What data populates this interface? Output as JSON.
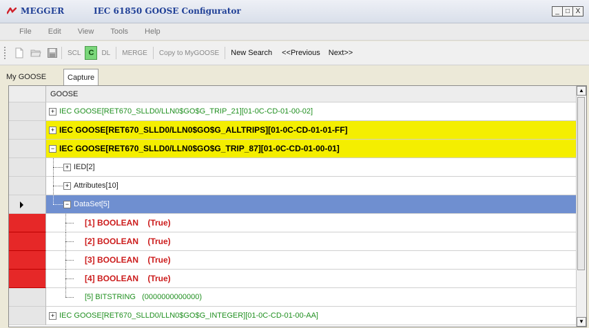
{
  "window": {
    "brand": "MEGGER",
    "title": "IEC 61850 GOOSE Configurator",
    "controls": [
      "_",
      "□",
      "X"
    ]
  },
  "menu": [
    "File",
    "Edit",
    "View",
    "Tools",
    "Help"
  ],
  "toolbar": {
    "scl": "SCL",
    "c": "C",
    "dl": "DL",
    "merge": "MERGE",
    "copy": "Copy to MyGOOSE",
    "new_search": "New Search",
    "previous": "<<Previous",
    "next": "Next>>"
  },
  "tabs": [
    "My GOOSE",
    "Capture"
  ],
  "grid": {
    "header": "GOOSE",
    "rows": [
      {
        "expander": "+",
        "text": "IEC GOOSE[RET670_SLLD0/LLN0$GO$G_TRIP_21][01-0C-CD-01-00-02]",
        "style": "green"
      },
      {
        "expander": "+",
        "text": "IEC GOOSE[RET670_SLLD0/LLN0$GO$G_ALLTRIPS][01-0C-CD-01-01-FF]",
        "style": "yellow"
      },
      {
        "expander": "−",
        "text": "IEC GOOSE[RET670_SLLD0/LLN0$GO$G_TRIP_87][01-0C-CD-01-00-01]",
        "style": "yellow"
      },
      {
        "expander": "+",
        "text": "IED[2]",
        "style": "child"
      },
      {
        "expander": "+",
        "text": "Attributes[10]",
        "style": "child"
      },
      {
        "expander": "−",
        "text": "DataSet[5]",
        "style": "selected"
      },
      {
        "text": "[1] BOOLEAN    (True)",
        "style": "red"
      },
      {
        "text": "[2] BOOLEAN    (True)",
        "style": "red"
      },
      {
        "text": "[3] BOOLEAN    (True)",
        "style": "red"
      },
      {
        "text": "[4] BOOLEAN    (True)",
        "style": "red"
      },
      {
        "text": "[5] BITSTRING   (0000000000000)",
        "style": "green-leaf"
      },
      {
        "expander": "+",
        "text": "IEC GOOSE[RET670_SLLD0/LLN0$GO$G_INTEGER][01-0C-CD-01-00-AA]",
        "style": "green"
      }
    ]
  },
  "scrollbar": {
    "up": "▲",
    "down": "▼"
  }
}
